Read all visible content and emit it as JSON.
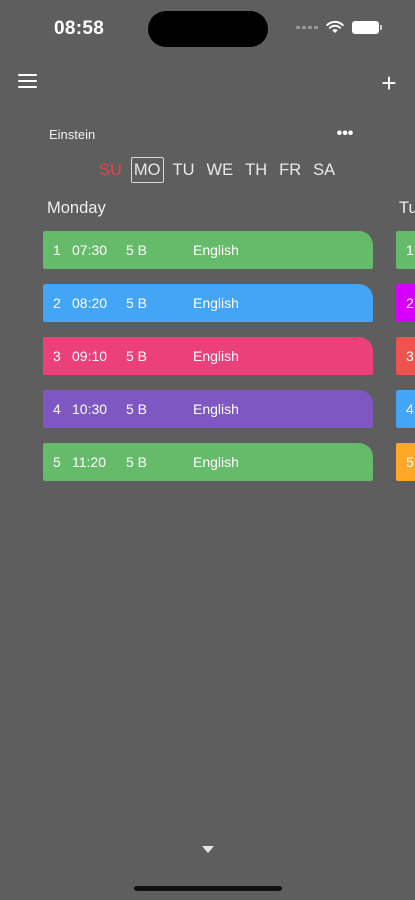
{
  "status_bar": {
    "time": "08:58"
  },
  "header": {
    "teacher": "Einstein",
    "more_label": "•••",
    "add_label": "+"
  },
  "days": [
    "SU",
    "MO",
    "TU",
    "WE",
    "TH",
    "FR",
    "SA"
  ],
  "selected_day": "MO",
  "current_day": {
    "title": "Monday"
  },
  "next_day": {
    "title": "Tu"
  },
  "lessons": [
    {
      "number": "1",
      "time": "07:30",
      "class": "5 B",
      "subject": "English",
      "color": "#66bb6a"
    },
    {
      "number": "2",
      "time": "08:20",
      "class": "5 B",
      "subject": "English",
      "color": "#42a5f5"
    },
    {
      "number": "3",
      "time": "09:10",
      "class": "5 B",
      "subject": "English",
      "color": "#ec407a"
    },
    {
      "number": "4",
      "time": "10:30",
      "class": "5 B",
      "subject": "English",
      "color": "#7e57c2"
    },
    {
      "number": "5",
      "time": "11:20",
      "class": "5 B",
      "subject": "English",
      "color": "#66bb6a"
    }
  ],
  "next_day_lessons": [
    {
      "number": "1",
      "color": "#66bb6a"
    },
    {
      "number": "2",
      "color": "#d500f9"
    },
    {
      "number": "3",
      "color": "#ef5350"
    },
    {
      "number": "4",
      "color": "#42a5f5"
    },
    {
      "number": "5",
      "color": "#ffa726"
    }
  ],
  "colors": {
    "background": "#5e5e5e",
    "sunday": "#e24545"
  }
}
